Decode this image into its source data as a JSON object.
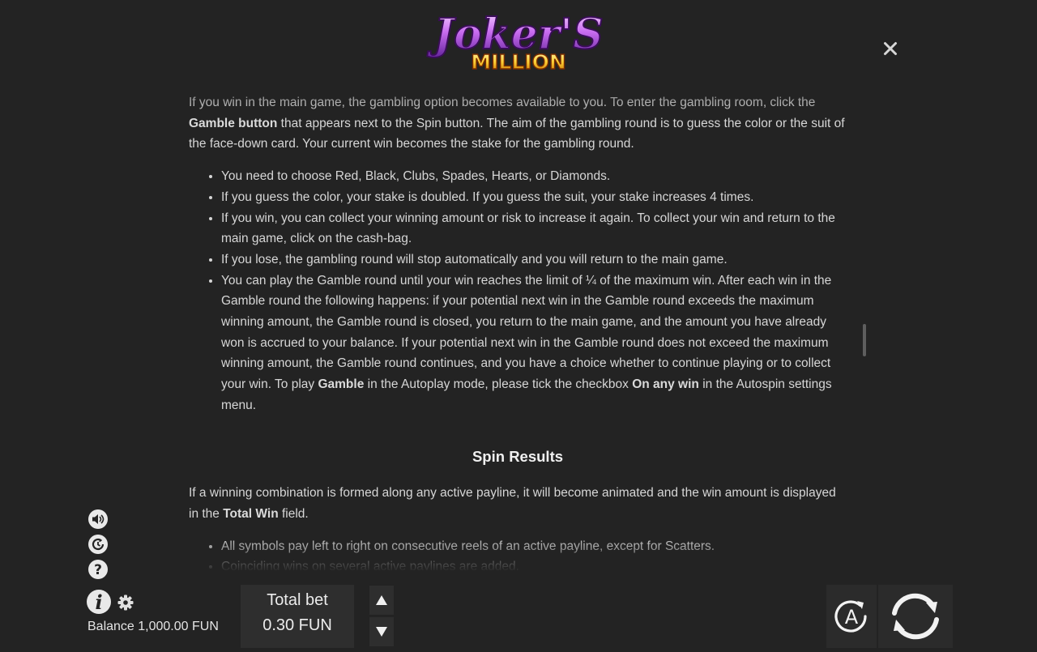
{
  "header": {
    "logo_line1": "Joker'S",
    "logo_line2": "MILLION",
    "close_icon": "close-icon"
  },
  "rules": {
    "gamble_intro": {
      "t1": "If you win in the main game, the gambling option becomes available to you. To enter the gambling room, click the ",
      "b1": "Gamble button",
      "t2": " that appears next to the Spin button. The aim of the gambling round is to guess the color or the suit of the face-down card. Your current win becomes the stake for the gambling round."
    },
    "gamble_bullets": {
      "b1": "You need to choose Red, Black, Clubs, Spades, Hearts, or Diamonds.",
      "b2": "If you guess the color, your stake is doubled. If you guess the suit, your stake increases 4 times.",
      "b3": "If you win, you can collect your winning amount or risk to increase it again. To collect your win and return to the main game, click on the cash-bag.",
      "b4": "If you lose, the gambling round will stop automatically and you will return to the main game.",
      "b5": {
        "t1": "You can play the Gamble round until your win reaches the limit of ¼ of the maximum win. After each win in the Gamble round the following happens: if your potential next win in the Gamble round exceeds the maximum winning amount, the Gamble round is closed, you return to the main game, and the amount you have already won is accrued to your balance. If your potential next win in the Gamble round does not exceed the maximum winning amount, the Gamble round continues, and you have a choice whether to continue playing or to collect your win. To play ",
        "b1": "Gamble",
        "t2": " in the Autoplay mode, please tick the checkbox ",
        "b2": "On any win",
        "t3": " in the Autospin settings menu."
      }
    },
    "spin_results_title": "Spin Results",
    "spin_results_intro": {
      "t1": "If a winning combination is formed along any active payline, it will become animated and the win amount is displayed in the ",
      "b1": "Total Win",
      "t2": " field."
    },
    "spin_bullets": {
      "b1": "All symbols pay left to right on consecutive reels of an active payline, except for Scatters.",
      "b2": "Coinciding wins on several active paylines are added."
    }
  },
  "footer": {
    "balance_text": "Balance 1,000.00 FUN",
    "total_bet_label": "Total bet",
    "total_bet_value": "0.30 FUN",
    "icons": [
      "sound-icon",
      "history-icon",
      "help-icon",
      "info-icon",
      "settings-icon",
      "bet-up-icon",
      "bet-down-icon",
      "autoplay-icon",
      "spin-icon"
    ]
  },
  "colors": {
    "background": "#232323",
    "text": "#d6d6d6",
    "heading": "#f0f0f0",
    "logo_purple": "#c96cf0",
    "logo_gold": "#ffcf33"
  }
}
